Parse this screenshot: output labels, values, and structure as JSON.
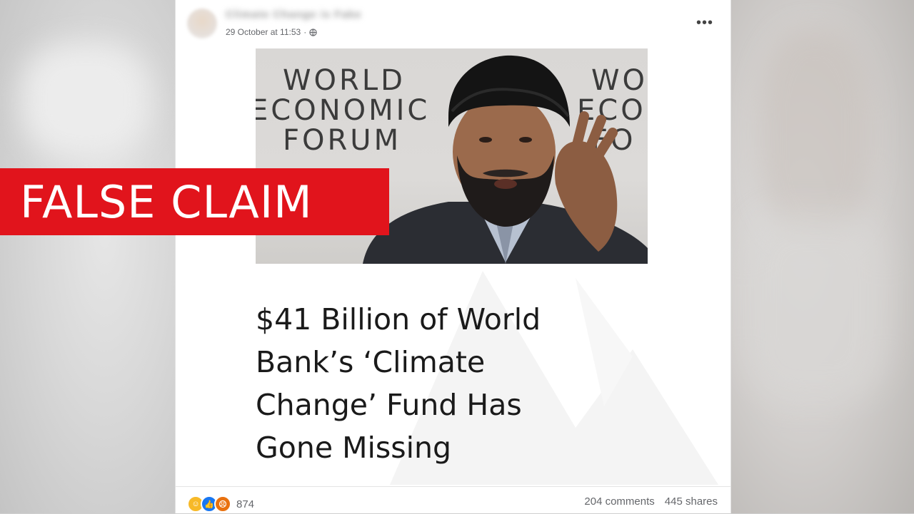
{
  "post": {
    "author_name": "Climate Change is Fake",
    "timestamp": "29 October at 11:53",
    "separator": "·",
    "privacy_icon": "globe-icon",
    "more_label": "•••"
  },
  "image": {
    "backdrop_text": {
      "line1": "WORLD",
      "line2": "ECONOMIC",
      "line3": "FORUM",
      "right_line1": "WO",
      "right_line2": "ECO",
      "right_line3": "FO"
    }
  },
  "headline": {
    "line1": "$41 Billion of World",
    "line2": "Bank’s ‘Climate",
    "line3": "Change’ Fund Has",
    "line4": "Gone Missing"
  },
  "footer": {
    "reaction_icons": [
      "haha-icon",
      "like-icon",
      "angry-icon"
    ],
    "reaction_count": "874",
    "comments": "204 comments",
    "shares": "445 shares"
  },
  "overlay": {
    "label": "FALSE CLAIM",
    "color": "#e1141c"
  }
}
